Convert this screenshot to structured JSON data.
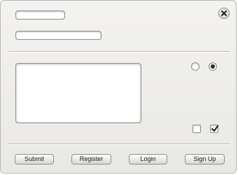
{
  "form": {
    "text_field_1": {
      "value": "",
      "placeholder": ""
    },
    "text_field_2": {
      "value": "",
      "placeholder": ""
    },
    "text_area": {
      "value": ""
    },
    "radio_1": {
      "selected": false
    },
    "radio_2": {
      "selected": true
    },
    "checkbox_1": {
      "checked": false
    },
    "checkbox_2": {
      "checked": true
    }
  },
  "buttons": {
    "submit": "Submit",
    "register": "Register",
    "login": "Login",
    "signup": "Sign Up"
  },
  "icons": {
    "close": "close-icon",
    "check": "checkmark-icon"
  }
}
